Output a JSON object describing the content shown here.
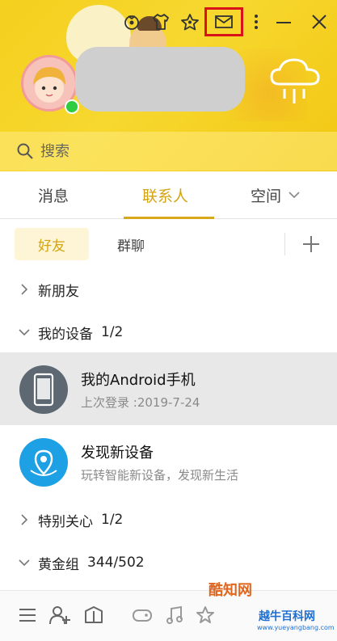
{
  "header": {
    "top_icons": [
      "skin-icon",
      "shirt-icon",
      "star-icon",
      "mail-icon",
      "more-icon",
      "minimize-icon",
      "close-icon"
    ],
    "highlight_color": "#d9121a",
    "brand_color": "#f4cf1e"
  },
  "search": {
    "placeholder": "搜索"
  },
  "tabs": [
    {
      "label": "消息"
    },
    {
      "label": "联系人"
    },
    {
      "label": "空间"
    }
  ],
  "accent_color": "#d4a413",
  "subtabs": [
    {
      "label": "好友"
    },
    {
      "label": "群聊"
    }
  ],
  "groups": {
    "new_friends": {
      "label": "新朋友"
    },
    "my_devices": {
      "label": "我的设备",
      "count": "1/2"
    },
    "special": {
      "label": "特别关心",
      "count": "1/2"
    },
    "gold": {
      "label": "黄金组",
      "count": "344/502"
    }
  },
  "devices": [
    {
      "name": "我的Android手机",
      "sub": "上次登录 :2019-7-24"
    },
    {
      "name": "发现新设备",
      "sub": "玩转智能新设备，发现新生活"
    }
  ],
  "footer_icons": [
    "menu-icon",
    "add-contact-icon",
    "app-manager-icon",
    "game-icon",
    "music-icon",
    "qzone-icon"
  ],
  "watermark": {
    "brand": "酷知网",
    "brand2": "越牛百科网",
    "url": "www.yueyangbang.com"
  }
}
